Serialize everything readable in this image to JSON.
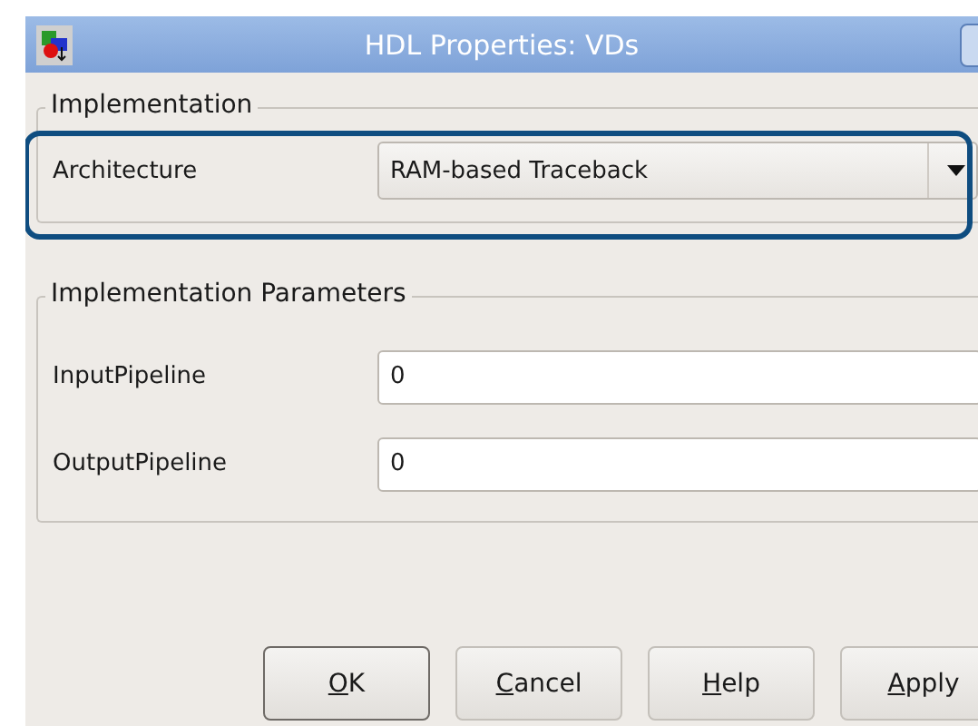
{
  "window": {
    "title": "HDL Properties: VDs"
  },
  "implementation": {
    "legend": "Implementation",
    "architecture": {
      "label": "Architecture",
      "value": "RAM-based Traceback",
      "highlighted": true
    }
  },
  "parameters": {
    "legend": "Implementation Parameters",
    "fields": [
      {
        "label": "InputPipeline",
        "value": "0"
      },
      {
        "label": "OutputPipeline",
        "value": "0"
      }
    ]
  },
  "buttons": [
    {
      "label": "OK",
      "default": true
    },
    {
      "label": "Cancel",
      "default": false
    },
    {
      "label": "Help",
      "default": false
    },
    {
      "label": "Apply",
      "default": false
    }
  ]
}
